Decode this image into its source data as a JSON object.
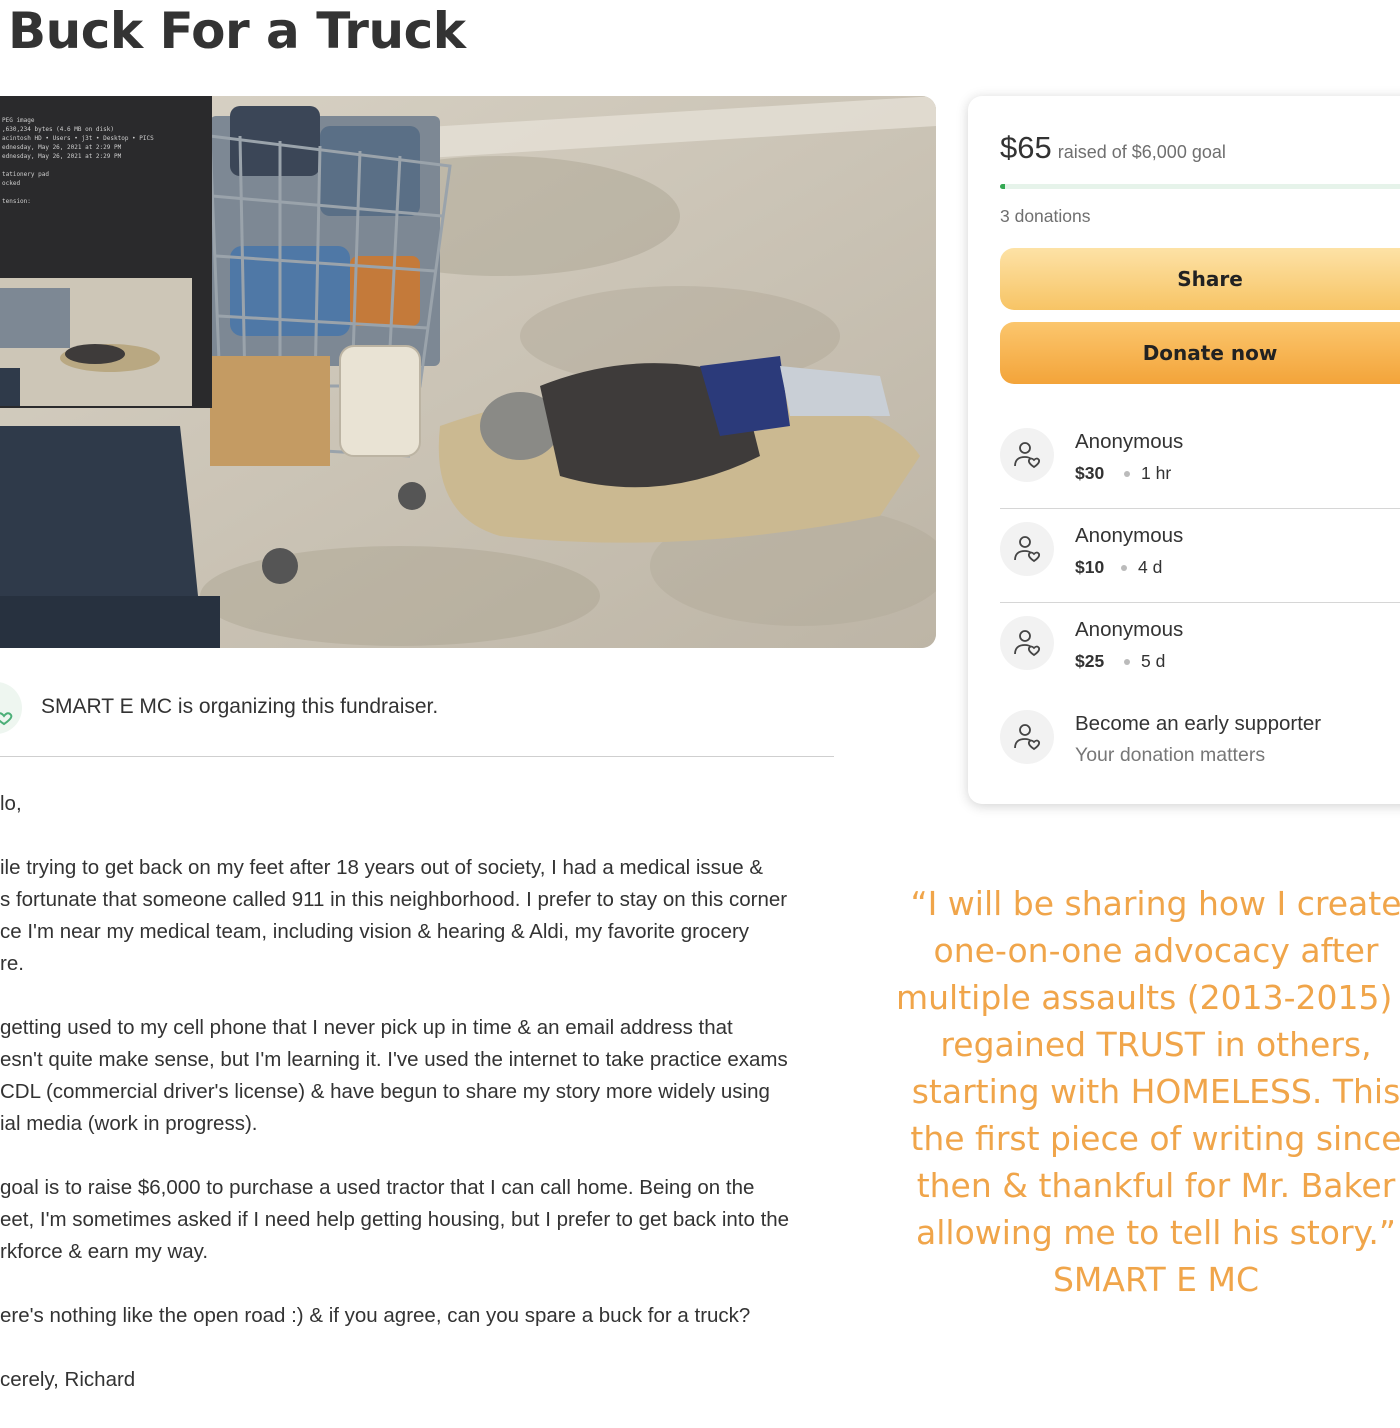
{
  "page": {
    "title": "Buck For a Truck"
  },
  "hero": {
    "overlay_meta": "PEG image\n,630,234 bytes (4.6 MB on disk)\nacintosh HD • Users • j3t • Desktop • PICS\nednesday, May 26, 2021 at 2:29 PM\nednesday, May 26, 2021 at 2:29 PM\n\ntationery pad\nocked\n\ntension:"
  },
  "organizer": {
    "text": "SMART E MC is organizing this fundraiser."
  },
  "story": {
    "paragraphs": [
      [
        "lo,"
      ],
      [
        "ile trying to get back on my feet after 18 years out of society, I had a medical issue &",
        "s fortunate that someone called 911 in this neighborhood. I prefer to stay on this corner",
        "ce I'm near my medical team, including vision & hearing & Aldi, my favorite grocery",
        "re."
      ],
      [
        "getting used to my cell phone that I never pick up in time & an email address that",
        "esn't quite make sense, but I'm learning it. I've used the internet to take practice exams",
        "CDL (commercial driver's license) & have begun to share my story more widely using",
        "ial media (work in progress)."
      ],
      [
        " goal is to raise $6,000 to purchase a used tractor that I can call home. Being on the",
        "eet, I'm sometimes asked if I need help getting housing, but I prefer to get back into the",
        "rkforce & earn my way."
      ],
      [
        "ere's nothing like the open road :) & if you agree, can you spare a buck for a truck?"
      ],
      [
        "cerely, Richard"
      ]
    ]
  },
  "card": {
    "raised_amount": "$65",
    "goal_text": "raised of $6,000 goal",
    "progress_fraction": 0.011,
    "donations_count": "3 donations",
    "share_label": "Share",
    "donate_label": "Donate now",
    "donors": [
      {
        "name": "Anonymous",
        "amount": "$30",
        "time": "1 hr"
      },
      {
        "name": "Anonymous",
        "amount": "$10",
        "time": "4 d"
      },
      {
        "name": "Anonymous",
        "amount": "$25",
        "time": "5 d"
      }
    ],
    "early": {
      "title": "Become an early supporter",
      "subtitle": "Your donation matters"
    }
  },
  "quote": {
    "lines": [
      "“I will be sharing how I create",
      "one-on-one advocacy after",
      "multiple assaults (2013-2015) &",
      "regained TRUST in others,",
      "starting with HOMELESS. This",
      "the first piece of writing since",
      "then & thankful for Mr. Baker",
      "allowing me to tell his story.”",
      "SMART E MC"
    ]
  },
  "colors": {
    "progress": "#34a853",
    "share_button": "#f7c465",
    "donate_button": "#f3a43a",
    "quote_text": "#f0a54a"
  },
  "icons": {
    "donor": "person-heart-icon",
    "organizer": "person-heart-icon"
  }
}
